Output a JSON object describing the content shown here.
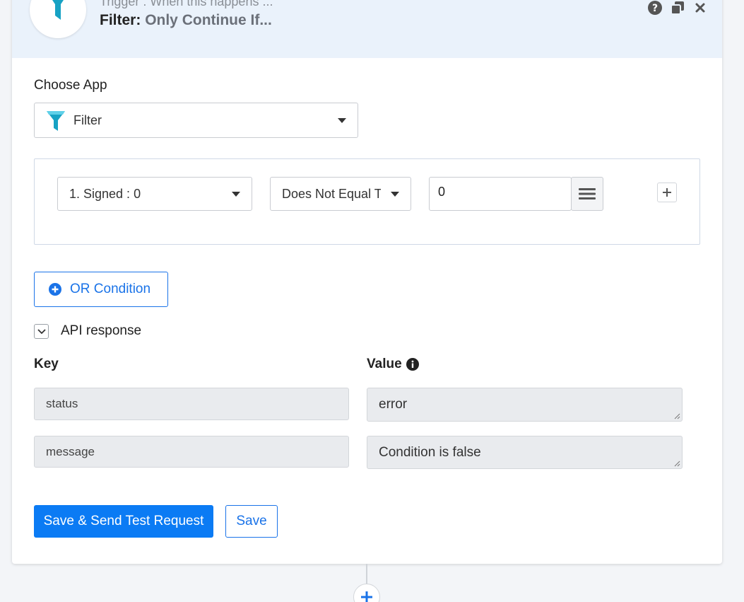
{
  "header": {
    "trigger_text": "Trigger : When this happens ...",
    "title_label": "Filter:",
    "title_value": "Only Continue If..."
  },
  "choose_app": {
    "label": "Choose App",
    "selected": "Filter"
  },
  "condition": {
    "field": "1. Signed : 0",
    "operator": "Does Not Equal To",
    "value": "0"
  },
  "or_condition_label": "OR Condition",
  "api_response": {
    "toggle_label": "API response",
    "key_header": "Key",
    "value_header": "Value",
    "rows": [
      {
        "key": "status",
        "value": "error"
      },
      {
        "key": "message",
        "value": "Condition is false"
      }
    ]
  },
  "actions": {
    "save_send_label": "Save & Send Test Request",
    "save_label": "Save"
  },
  "colors": {
    "accent": "#0b7bf4",
    "header_bg": "#eaf2fb",
    "filter_icon": "#17a2c4"
  },
  "icons": [
    "filter-icon",
    "help-icon",
    "copy-icon",
    "close-icon",
    "caret-down-icon",
    "hamburger-icon",
    "plus-icon",
    "plus-circle-icon",
    "chevron-down-icon",
    "info-icon"
  ]
}
